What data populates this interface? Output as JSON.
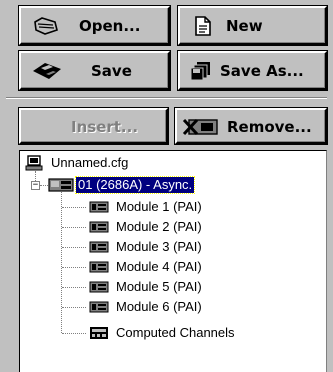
{
  "toolbar": {
    "open_label": "Open...",
    "new_label": "New",
    "save_label": "Save",
    "save_as_label": "Save As...",
    "insert_label": "Insert...",
    "remove_label": "Remove..."
  },
  "tree": {
    "root": {
      "label": "Unnamed.cfg",
      "icon": "computer-icon"
    },
    "instrument": {
      "label": "01 (2686A) - Async.",
      "icon": "instrument-icon",
      "expander": "−"
    },
    "children": [
      {
        "label": "Module 1 (PAI)",
        "icon": "module-icon"
      },
      {
        "label": "Module 2 (PAI)",
        "icon": "module-icon"
      },
      {
        "label": "Module 3 (PAI)",
        "icon": "module-icon"
      },
      {
        "label": "Module 4 (PAI)",
        "icon": "module-icon"
      },
      {
        "label": "Module 5 (PAI)",
        "icon": "module-icon"
      },
      {
        "label": "Module 6 (PAI)",
        "icon": "module-icon"
      },
      {
        "label": "Computed Channels",
        "icon": "calculator-icon"
      }
    ]
  }
}
